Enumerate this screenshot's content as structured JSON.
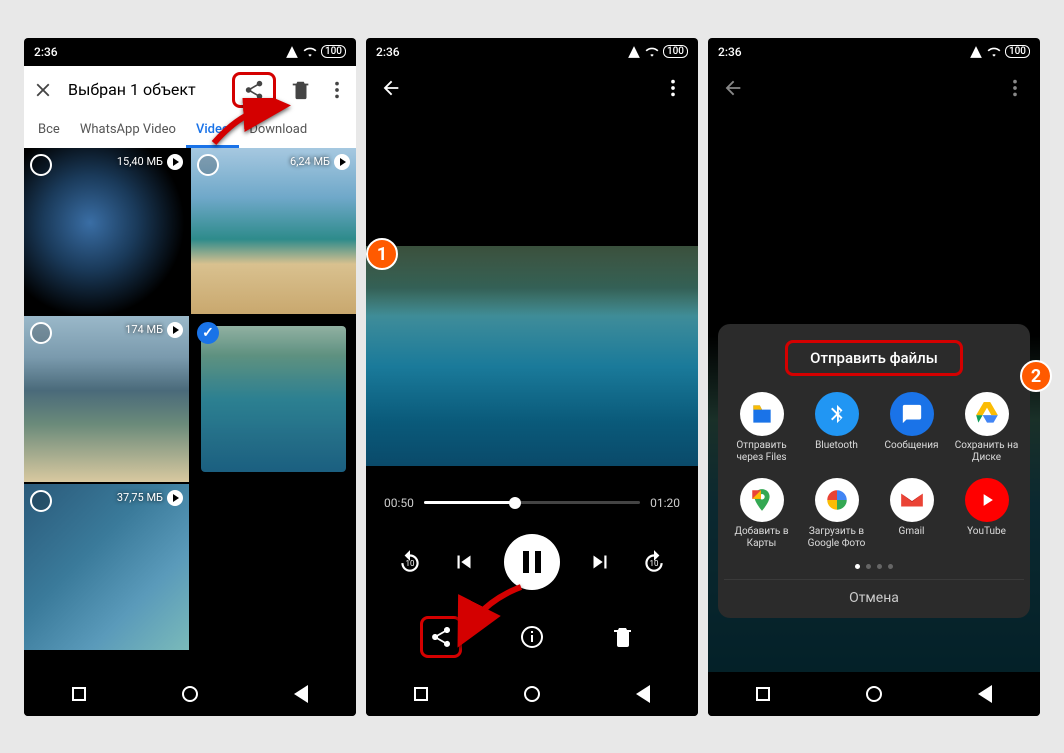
{
  "status": {
    "time": "2:36",
    "battery": "100"
  },
  "phone1": {
    "appbar": {
      "title": "Выбран 1 объект"
    },
    "tabs": {
      "all": "Все",
      "whatsapp": "WhatsApp Video",
      "video": "Video",
      "download": "Download"
    },
    "thumbs": {
      "0": {
        "size": "15,40 МБ"
      },
      "1": {
        "size": "6,24 МБ"
      },
      "2": {
        "size": "174 МБ"
      },
      "3": {
        "size": ""
      },
      "4": {
        "size": "37,75 МБ"
      }
    }
  },
  "phone2": {
    "seek": {
      "current": "00:50",
      "total": "01:20"
    },
    "replay_label": "10",
    "forward_label": "10"
  },
  "phone3": {
    "sheet": {
      "title": "Отправить файлы",
      "apps": {
        "files": "Отправить через Files",
        "bt": "Bluetooth",
        "msg": "Сообщения",
        "drive": "Сохранить на Диске",
        "maps": "Добавить в Карты",
        "photos": "Загрузить в Google Фото",
        "gmail": "Gmail",
        "yt": "YouTube"
      },
      "cancel": "Отмена"
    }
  },
  "badges": {
    "one": "1",
    "two": "2"
  }
}
